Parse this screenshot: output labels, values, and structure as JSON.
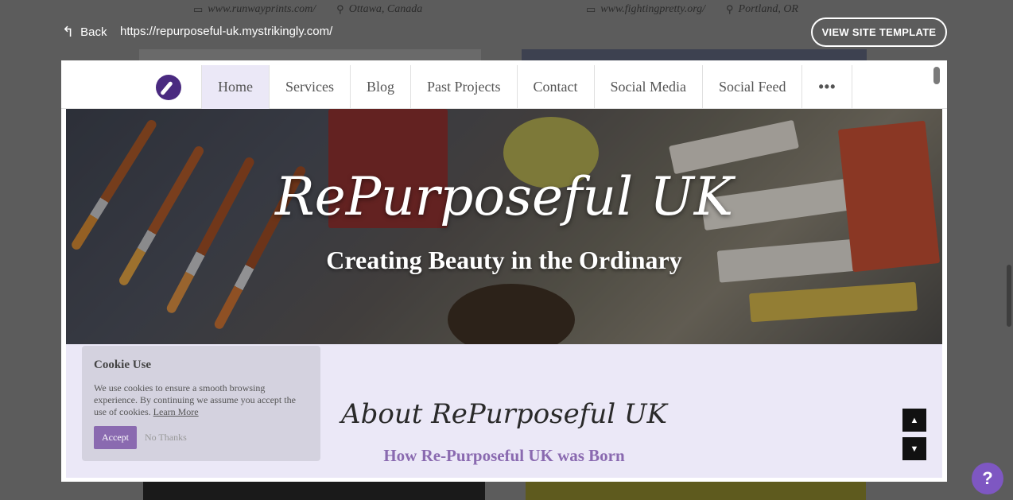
{
  "background": {
    "left_site": {
      "url": "www.runwayprints.com/",
      "location": "Ottawa, Canada",
      "url_icon": "monitor-icon",
      "location_icon": "map-pin-icon"
    },
    "right_site": {
      "url": "www.fightingpretty.org/",
      "location": "Portland, OR",
      "url_icon": "monitor-icon",
      "location_icon": "map-pin-icon"
    }
  },
  "toolbar": {
    "back_label": "Back",
    "back_icon": "back-arrow-icon",
    "url": "https://repurposeful-uk.mystrikingly.com/",
    "view_template_label": "VIEW SITE TEMPLATE"
  },
  "site": {
    "logo_icon": "brand-logo-icon",
    "nav": [
      "Home",
      "Services",
      "Blog",
      "Past Projects",
      "Contact",
      "Social Media",
      "Social Feed",
      "•••"
    ],
    "active_nav": "Home",
    "hero_title": "RePurposeful UK",
    "hero_subtitle": "Creating Beauty in the Ordinary",
    "about_title": "About RePurposeful UK",
    "about_subtitle": "How Re-Purposeful UK was Born",
    "accent_color": "#8a6ab0",
    "section_bg": "#ebe8f7"
  },
  "cookie": {
    "title": "Cookie Use",
    "text": "We use cookies to ensure a smooth browsing experience. By continuing we assume you accept the use of cookies.",
    "learn_more": "Learn More",
    "accept_label": "Accept",
    "no_thanks_label": "No Thanks"
  },
  "section_nav": {
    "up_icon": "triangle-up-icon",
    "down_icon": "triangle-down-icon"
  },
  "help": {
    "label": "?",
    "icon": "help-icon",
    "color": "#7e57c2"
  }
}
